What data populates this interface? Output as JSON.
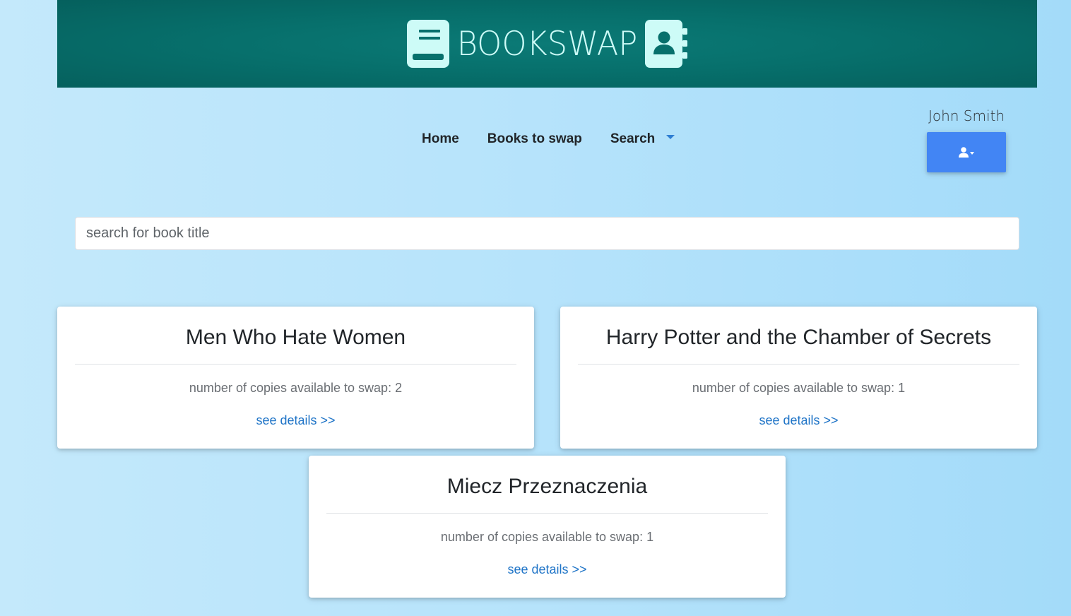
{
  "header": {
    "logo_text": "BOOKSWAP",
    "left_icon": "book-icon",
    "right_icon": "address-book-icon",
    "color": "#06706c"
  },
  "nav": {
    "items": [
      {
        "label": "Home"
      },
      {
        "label": "Books to swap"
      },
      {
        "label": "Search"
      }
    ]
  },
  "user": {
    "name": "John Smith",
    "button_icon": "user-icon",
    "button_color": "#4285f4"
  },
  "search": {
    "placeholder": "search for book title",
    "value": ""
  },
  "books": [
    {
      "title": "Men Who Hate Women",
      "copies_text": "number of copies available to swap: 2",
      "link": "see details >>"
    },
    {
      "title": "Harry Potter and the Chamber of Secrets",
      "copies_text": "number of copies available to swap: 1",
      "link": "see details >>"
    },
    {
      "title": "Miecz Przeznaczenia",
      "copies_text": "number of copies available to swap: 1",
      "link": "see details >>"
    }
  ],
  "colors": {
    "link": "#1f74c7",
    "background": "#b6e3fb"
  }
}
